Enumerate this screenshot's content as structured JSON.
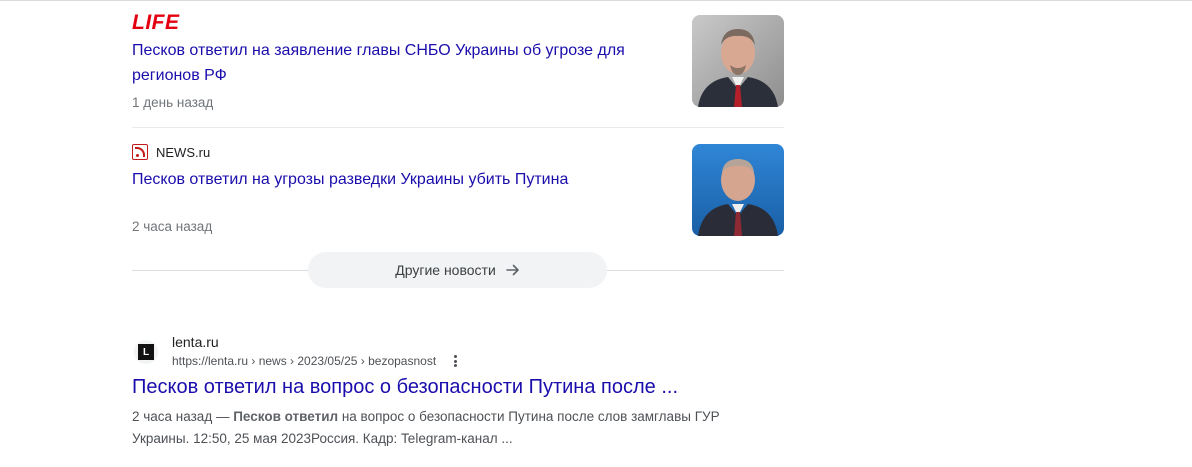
{
  "news_cards": [
    {
      "source_logo_text": "LIFE",
      "headline": "Песков ответил на заявление главы СНБО Украины об угрозе для регионов РФ",
      "time": "1 день назад",
      "thumbnail_icon": "person-photo-thumbnail"
    },
    {
      "source_name": "NEWS.ru",
      "source_icon": "rss-feed-icon",
      "headline": "Песков ответил на угрозы разведки Украины убить Путина",
      "time": "2 часа назад",
      "thumbnail_icon": "person-photo-thumbnail"
    }
  ],
  "more_news": {
    "label": "Другие новости"
  },
  "result": {
    "favicon_letter": "L",
    "site_name": "lenta.ru",
    "url": "https://lenta.ru › news › 2023/05/25 › bezopasnost",
    "title": "Песков ответил на вопрос о безопасности Путина после ...",
    "snippet_date": "2 часа назад — ",
    "snippet_bold": "Песков ответил",
    "snippet_rest": " на вопрос о безопасности Путина после слов замглавы ГУР Украины. 12:50, 25 мая 2023Россия. Кадр: Telegram-канал ..."
  },
  "colors": {
    "link": "#1a0dab",
    "life_red": "#e3000f",
    "meta": "#70757a"
  }
}
